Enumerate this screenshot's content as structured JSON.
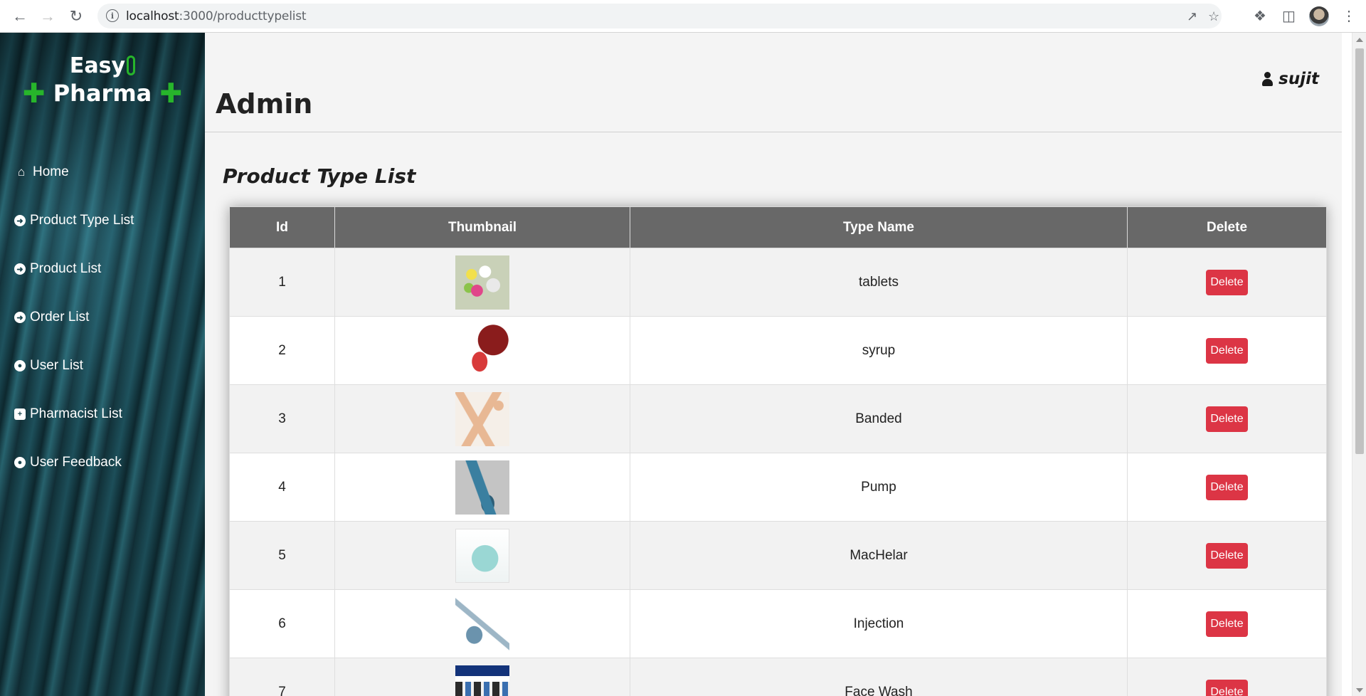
{
  "browser": {
    "url_host": "localhost",
    "url_path": ":3000/producttypelist"
  },
  "brand": {
    "line1": "Easy",
    "line2": "Pharma"
  },
  "sidebar": {
    "items": [
      {
        "label": "Home",
        "icon": "home-icon"
      },
      {
        "label": "Product Type List",
        "icon": "arrow-circle-right-icon"
      },
      {
        "label": "Product List",
        "icon": "arrow-circle-right-icon"
      },
      {
        "label": "Order List",
        "icon": "arrow-circle-right-icon"
      },
      {
        "label": "User List",
        "icon": "user-circle-icon"
      },
      {
        "label": "Pharmacist List",
        "icon": "medkit-icon"
      },
      {
        "label": "User Feedback",
        "icon": "user-circle-icon"
      }
    ]
  },
  "header": {
    "title": "Admin",
    "username": "sujit"
  },
  "page": {
    "title": "Product Type List"
  },
  "table": {
    "columns": [
      "Id",
      "Thumbnail",
      "Type Name",
      "Delete"
    ],
    "rows": [
      {
        "id": "1",
        "type_name": "tablets",
        "delete_label": "Delete"
      },
      {
        "id": "2",
        "type_name": "syrup",
        "delete_label": "Delete"
      },
      {
        "id": "3",
        "type_name": "Banded",
        "delete_label": "Delete"
      },
      {
        "id": "4",
        "type_name": "Pump",
        "delete_label": "Delete"
      },
      {
        "id": "5",
        "type_name": "MacHelar",
        "delete_label": "Delete"
      },
      {
        "id": "6",
        "type_name": "Injection",
        "delete_label": "Delete"
      },
      {
        "id": "7",
        "type_name": "Face Wash",
        "delete_label": "Delete"
      }
    ]
  },
  "colors": {
    "delete_button": "#dc3545",
    "table_header": "#686868",
    "brand_green": "#27b52b"
  }
}
